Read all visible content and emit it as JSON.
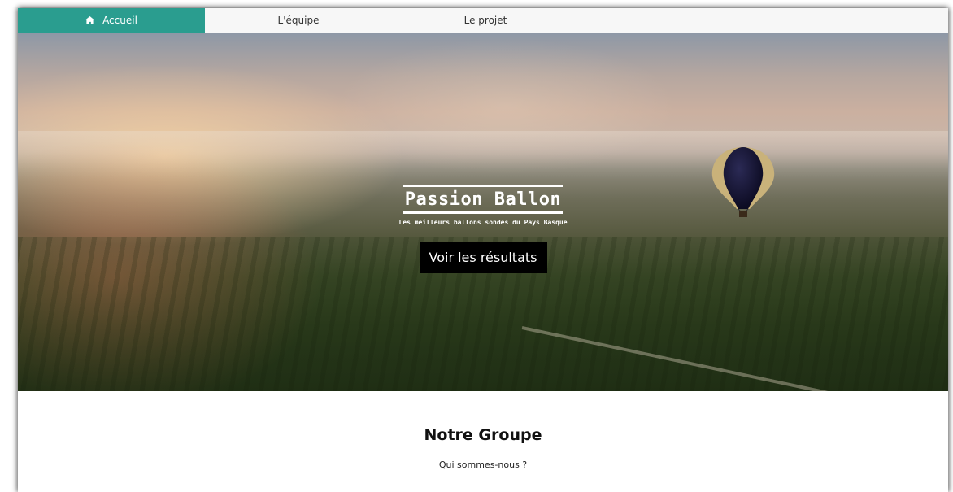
{
  "nav": {
    "items": [
      {
        "label": "Accueil",
        "icon": "home-icon",
        "active": true
      },
      {
        "label": "L'équipe",
        "active": false
      },
      {
        "label": "Le projet",
        "active": false
      }
    ],
    "active_color": "#2a9d8f"
  },
  "hero": {
    "title": "Passion Ballon",
    "subtitle": "Les meilleurs ballons sondes du Pays Basque",
    "cta_label": "Voir les résultats"
  },
  "section": {
    "title": "Notre Groupe",
    "subtitle": "Qui sommes-nous ?"
  }
}
